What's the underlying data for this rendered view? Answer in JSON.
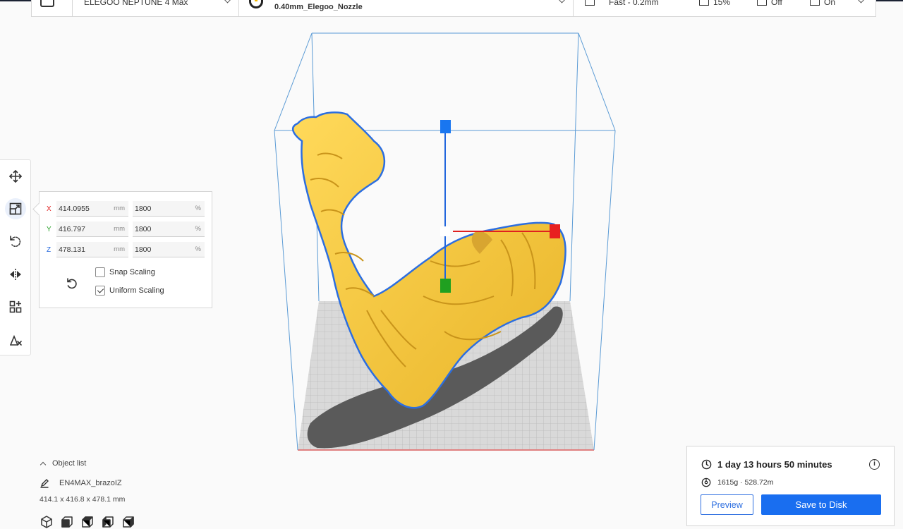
{
  "header": {
    "printer_name": "ELEGOO NEPTUNE 4 Max",
    "nozzle_label": "0.40mm_Elegoo_Nozzle",
    "profile_label": "Fast - 0.2mm",
    "infill_label": "15%",
    "support_label": "Off",
    "adhesion_label": "On"
  },
  "toolbar": {
    "tools": [
      "move-icon",
      "scale-icon",
      "rotate-icon",
      "mirror-icon",
      "per-model-settings-icon",
      "support-blocker-icon"
    ],
    "active": "scale-icon"
  },
  "scale_panel": {
    "rows": [
      {
        "axis": "X",
        "axis_color": "#e02020",
        "mm": "414.0955",
        "pct": "1800"
      },
      {
        "axis": "Y",
        "axis_color": "#2aa12a",
        "mm": "416.797",
        "pct": "1800"
      },
      {
        "axis": "Z",
        "axis_color": "#2266dd",
        "mm": "478.131",
        "pct": "1800"
      }
    ],
    "unit_mm": "mm",
    "unit_pct": "%",
    "snap_scaling_label": "Snap Scaling",
    "snap_scaling_checked": false,
    "uniform_scaling_label": "Uniform Scaling",
    "uniform_scaling_checked": true
  },
  "object_list": {
    "title": "Object list",
    "object_name": "EN4MAX_brazoIZ",
    "dimensions": "414.1 x 416.8 x 478.1 mm",
    "view_icons": [
      "3d-view-icon",
      "front-view-icon",
      "top-view-icon",
      "left-view-icon",
      "right-view-icon"
    ]
  },
  "print_panel": {
    "time": "1 day 13 hours 50 minutes",
    "material": "1615g · 528.72m",
    "preview_label": "Preview",
    "save_label": "Save to Disk"
  },
  "colors": {
    "accent": "#196ef0",
    "model": "#f5c842",
    "build_volume": "#5b9bd5"
  }
}
